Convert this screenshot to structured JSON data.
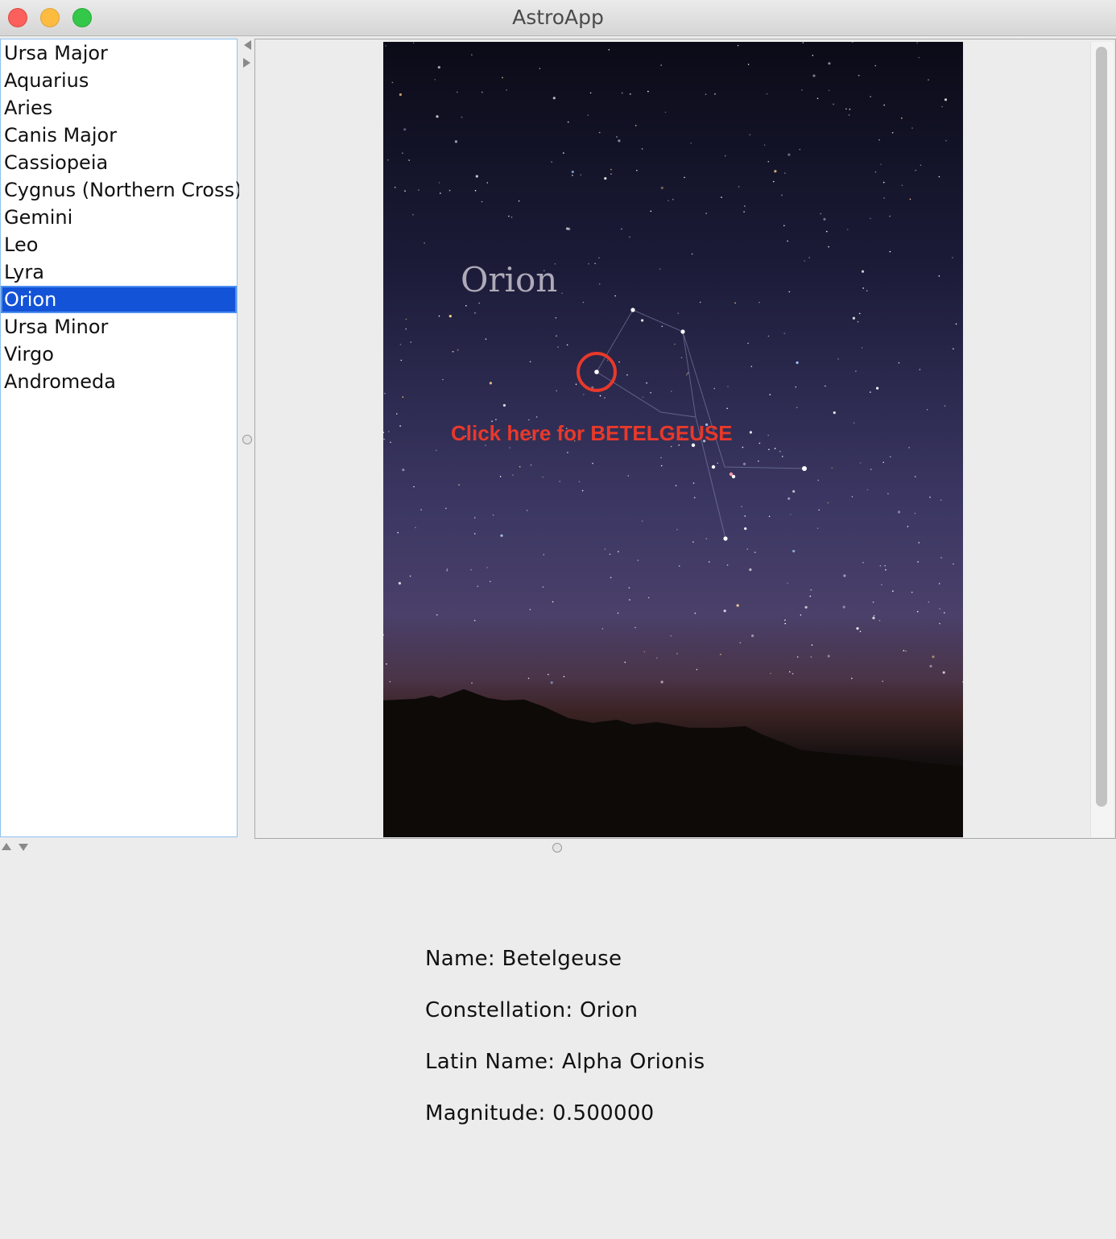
{
  "window": {
    "title": "AstroApp"
  },
  "constellations": {
    "items": [
      "Ursa Major",
      "Aquarius",
      "Aries",
      "Canis Major",
      "Cassiopeia",
      "Cygnus (Northern Cross)",
      "Gemini",
      "Leo",
      "Lyra",
      "Orion",
      "Ursa Minor",
      "Virgo",
      "Andromeda"
    ],
    "selected": "Orion"
  },
  "image": {
    "constellation_label": "Orion",
    "hint": "Click here for BETELGEUSE",
    "hint_color": "#e8392a"
  },
  "details": {
    "name": "Name: Betelgeuse",
    "constellation": "Constellation: Orion",
    "latin_name": "Latin Name: Alpha Orionis",
    "magnitude": "Magnitude: 0.500000"
  }
}
